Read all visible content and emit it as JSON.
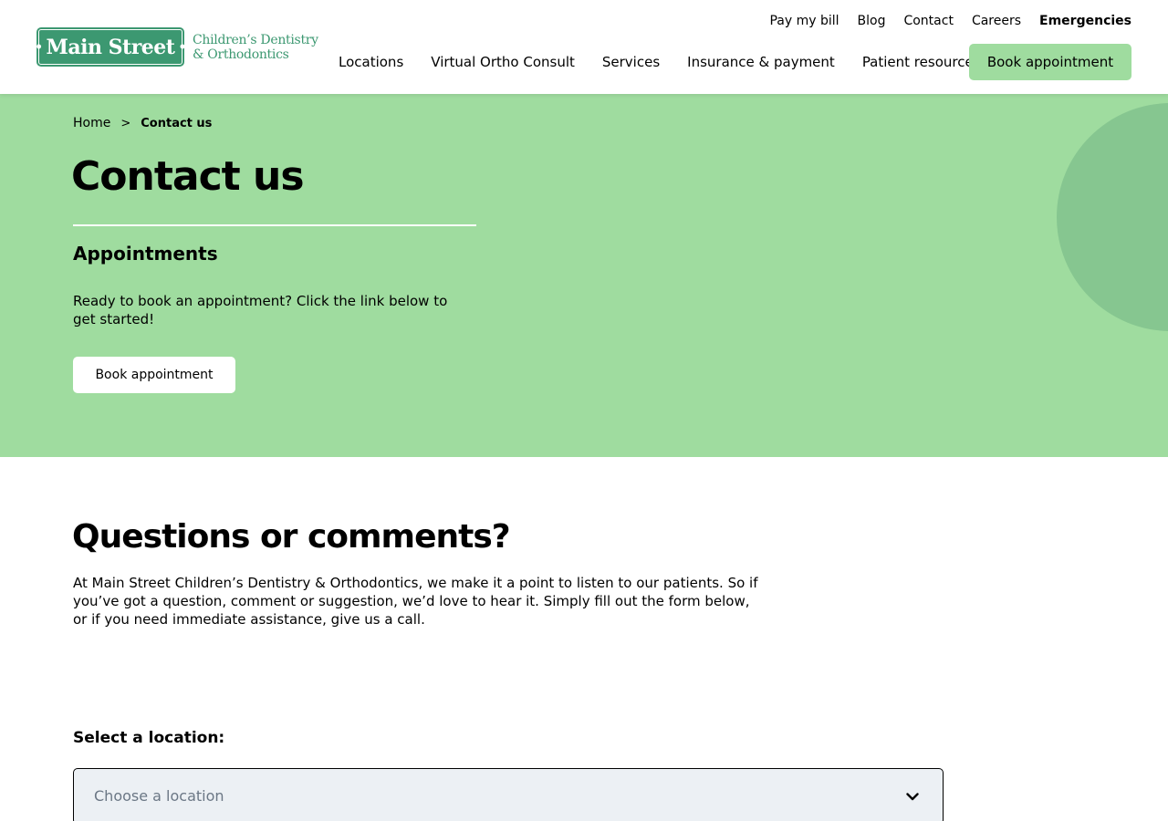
{
  "logo": {
    "main": "Main Street",
    "sub_line1": "Children’s Dentistry",
    "sub_line2": "& Orthodontics"
  },
  "utility_nav": [
    {
      "label": "Pay my bill"
    },
    {
      "label": "Blog"
    },
    {
      "label": "Contact"
    },
    {
      "label": "Careers"
    },
    {
      "label": "Emergencies"
    }
  ],
  "main_nav": [
    {
      "label": "Locations"
    },
    {
      "label": "Virtual Ortho Consult"
    },
    {
      "label": "Services"
    },
    {
      "label": "Insurance & payment"
    },
    {
      "label": "Patient resources"
    }
  ],
  "header": {
    "book_label": "Book appointment"
  },
  "breadcrumb": {
    "home": "Home",
    "separator": ">",
    "current": "Contact us"
  },
  "hero": {
    "title": "Contact us",
    "subtitle": "Appointments",
    "text": "Ready to book an appointment? Click the link below to get started!",
    "book_label": "Book appointment"
  },
  "questions": {
    "title": "Questions or comments?",
    "text": "At Main Street Children’s Dentistry & Orthodontics, we make it a point to listen to our patients. So if you’ve got a question, comment or suggestion, we’d love to hear it. Simply fill out the form below, or if you need immediate assistance, give us a call."
  },
  "location_select": {
    "label": "Select a location:",
    "placeholder": "Choose a location",
    "icon": "chevron-down-icon"
  },
  "colors": {
    "brand_green": "#3c9871",
    "hero_green": "#9fdc9f",
    "hero_circle": "#86c690",
    "select_bg": "#ecf0f4"
  }
}
